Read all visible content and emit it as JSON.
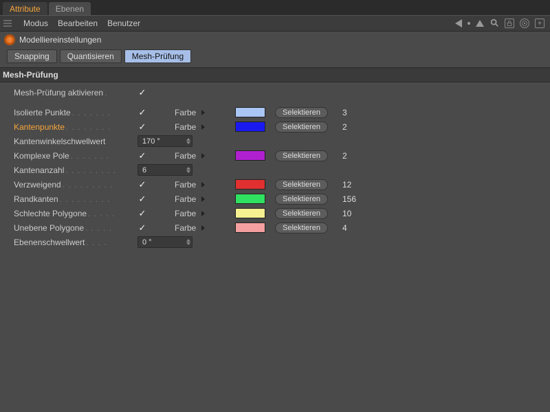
{
  "top_tabs": {
    "attribute": "Attribute",
    "ebenen": "Ebenen"
  },
  "menubar": {
    "modus": "Modus",
    "bearbeiten": "Bearbeiten",
    "benutzer": "Benutzer"
  },
  "title": "Modelliereinstellungen",
  "inner_tabs": {
    "snapping": "Snapping",
    "quantisieren": "Quantisieren",
    "mesh": "Mesh-Prüfung"
  },
  "section": "Mesh-Prüfung",
  "labels": {
    "enable": "Mesh-Prüfung aktivieren",
    "farbe": "Farbe",
    "selektieren": "Selektieren"
  },
  "rows": {
    "isolated": {
      "label": "Isolierte Punkte",
      "checked": true,
      "color": "#a9c6f4",
      "count": 3
    },
    "edgepoints": {
      "label": "Kantenpunkte",
      "checked": true,
      "color": "#1a1af0",
      "count": 2
    },
    "edgeangle": {
      "label": "Kantenwinkelschwellwert",
      "value": "170 °"
    },
    "complex": {
      "label": "Komplexe Pole",
      "checked": true,
      "color": "#b020d0",
      "count": 2
    },
    "edgecount": {
      "label": "Kantenanzahl",
      "value": "6"
    },
    "branching": {
      "label": "Verzweigend",
      "checked": true,
      "color": "#e03030",
      "count": 12
    },
    "boundary": {
      "label": "Randkanten",
      "checked": true,
      "color": "#30e060",
      "count": 156
    },
    "badpoly": {
      "label": "Schlechte Polygone",
      "checked": true,
      "color": "#f5f090",
      "count": 10
    },
    "nonplanar": {
      "label": "Unebene Polygone",
      "checked": true,
      "color": "#f4a0a0",
      "count": 4
    },
    "planethresh": {
      "label": "Ebenenschwellwert",
      "value": "0 °"
    }
  },
  "enable_checked": true
}
